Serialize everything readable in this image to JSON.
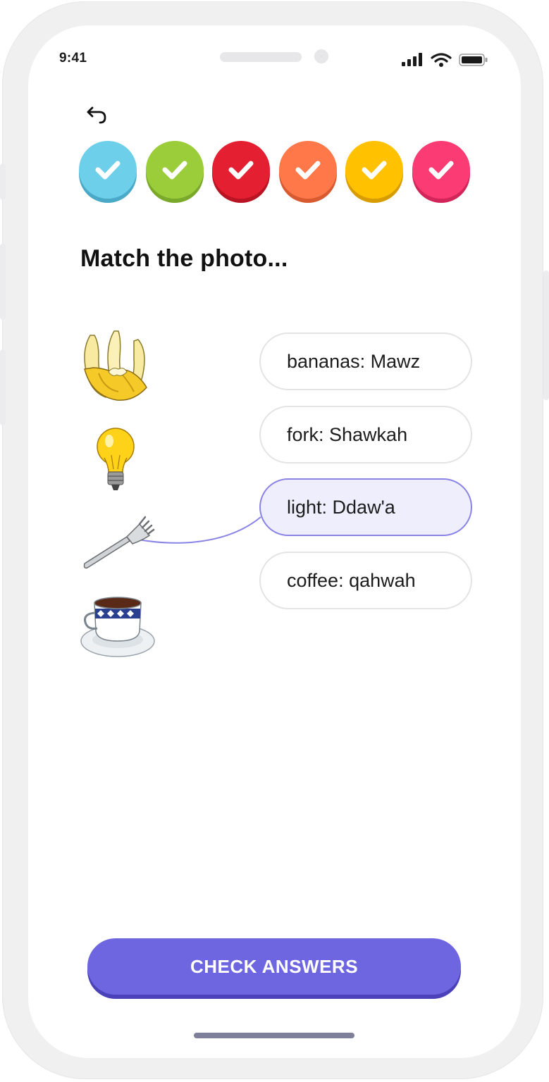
{
  "status_bar": {
    "time": "9:41",
    "icons": [
      "signal-icon",
      "wifi-icon",
      "battery-icon"
    ]
  },
  "back_icon": "undo-arrow-icon",
  "progress": {
    "steps": [
      {
        "state": "complete",
        "color": "#6dcfea",
        "shadow": "#4ba9c8"
      },
      {
        "state": "complete",
        "color": "#9bcd3a",
        "shadow": "#7aa82a"
      },
      {
        "state": "complete",
        "color": "#e31f31",
        "shadow": "#b91423"
      },
      {
        "state": "complete",
        "color": "#ff7849",
        "shadow": "#d85a30"
      },
      {
        "state": "complete",
        "color": "#ffc100",
        "shadow": "#d79d00"
      },
      {
        "state": "complete",
        "color": "#fb3b73",
        "shadow": "#d2265a"
      }
    ]
  },
  "prompt": "Match the photo...",
  "pictures": [
    {
      "name": "bananas-image"
    },
    {
      "name": "light-bulb-image"
    },
    {
      "name": "fork-image"
    },
    {
      "name": "coffee-cup-image"
    }
  ],
  "options": [
    {
      "label": "bananas: Mawz",
      "selected": false
    },
    {
      "label": "fork: Shawkah",
      "selected": false
    },
    {
      "label": "light: Ddaw'a",
      "selected": true
    },
    {
      "label": "coffee: qahwah",
      "selected": false
    }
  ],
  "check_button": "CHECK ANSWERS",
  "colors": {
    "accent": "#6e66e0",
    "accent_dark": "#4b41b8",
    "selected_fill": "#eeeefc",
    "selected_border": "#8a83e6"
  }
}
